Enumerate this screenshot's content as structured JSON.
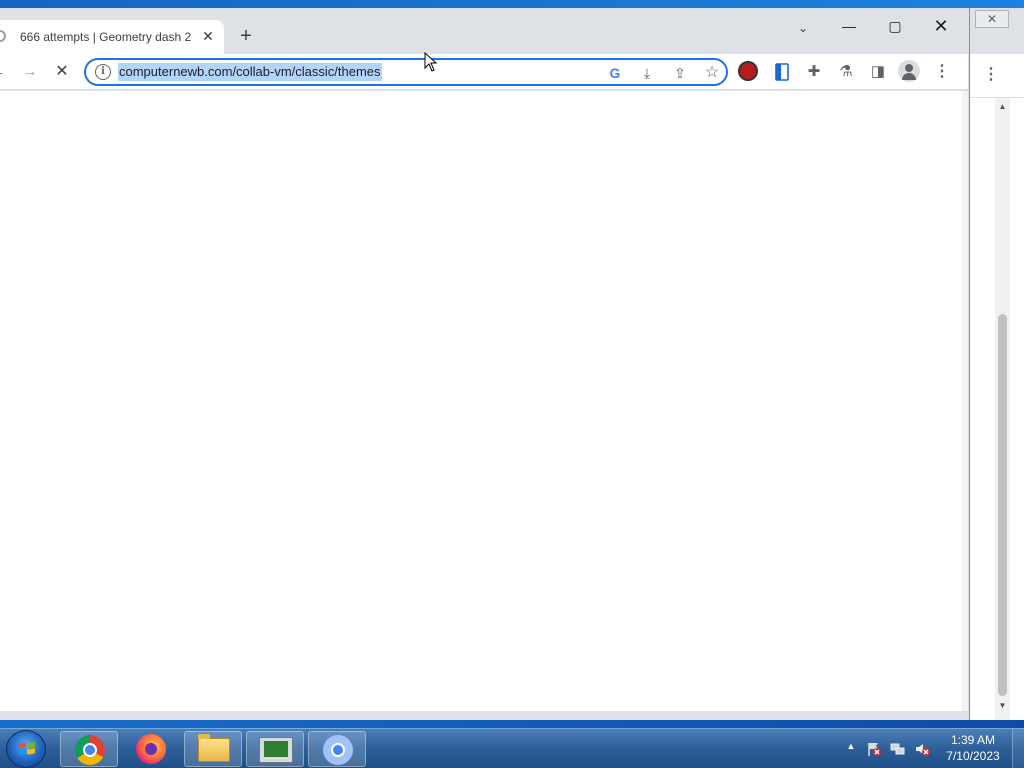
{
  "browser": {
    "tab": {
      "title": "666 attempts | Geometry dash 2",
      "close_glyph": "✕"
    },
    "new_tab_glyph": "+",
    "tab_search_glyph": "⌄",
    "window_controls": {
      "minimize": "—",
      "maximize": "▢",
      "close": "✕"
    },
    "toolbar": {
      "back_glyph": "←",
      "forward_glyph": "→",
      "stop_glyph": "✕",
      "url": "computernewb.com/collab-vm/classic/themes",
      "info_glyph": "i",
      "lens_glyph": "G",
      "install_glyph": "⤓",
      "share_glyph": "⇪",
      "bookmark_glyph": "☆",
      "extensions_glyph": "✚",
      "labs_glyph": "⚗",
      "sidepanel_glyph": "◨",
      "menu_glyph": "⋮"
    },
    "icons": {
      "ext1": "red-extension-icon",
      "ext2": "document-extension-icon",
      "profile": "profile-avatar-icon"
    }
  },
  "background_window": {
    "close_glyph": "✕",
    "menu_glyph": "⋮",
    "scroll_up_glyph": "▲",
    "scroll_down_glyph": "▼"
  },
  "taskbar": {
    "clock_time": "1:39 AM",
    "clock_date": "7/10/2023",
    "tray_arrow_glyph": "▲",
    "apps": [
      "chrome",
      "firefox",
      "explorer",
      "vm-console",
      "chromium"
    ]
  },
  "colors": {
    "accent": "#1a73e8",
    "selection": "#b3d4fc",
    "taskbar": "#2d5f99"
  }
}
